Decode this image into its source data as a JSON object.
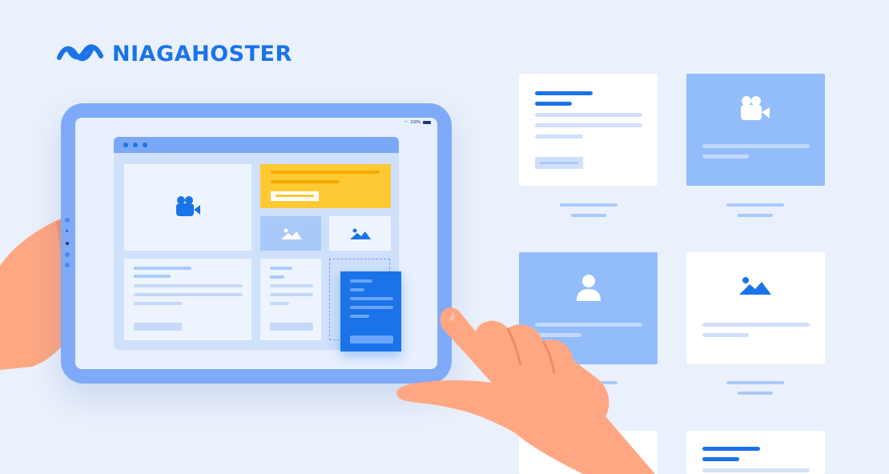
{
  "brand": {
    "name": "NIAGAHOSTER",
    "color": "#1a73e8"
  },
  "tablet": {
    "status_text": "100%",
    "highlight_card_color": "#ffc933",
    "dragged_card_color": "#1a73e8"
  },
  "palette": {
    "background": "#eaf1fc",
    "card_blue": "#93bcfa",
    "hand": "#ffa783"
  },
  "icons": [
    "camera-icon",
    "image-icon",
    "user-icon"
  ]
}
